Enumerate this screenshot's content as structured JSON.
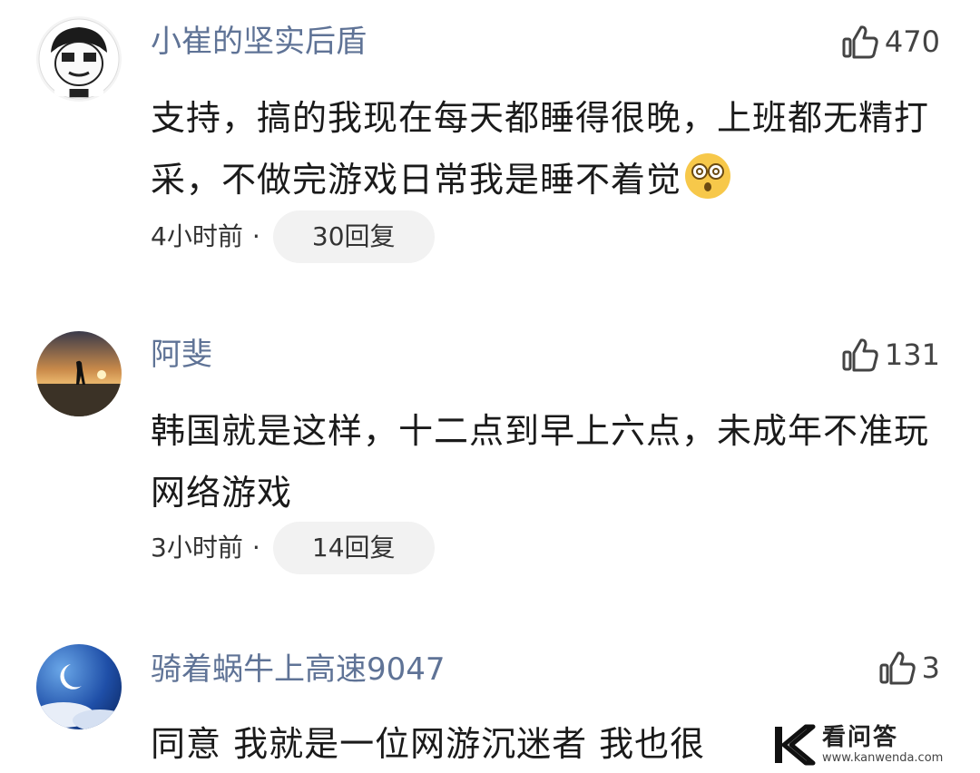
{
  "comments": [
    {
      "username": "小崔的坚实后盾",
      "likes": "470",
      "text": "支持，搞的我现在每天都睡得很晚，上班都无精打采，不做完游戏日常我是睡不着觉",
      "emoji": "dizzy-face-emoji",
      "time": "4小时前",
      "dot": "·",
      "reply_label": "30回复"
    },
    {
      "username": "阿斐",
      "likes": "131",
      "text": "韩国就是这样，十二点到早上六点，未成年不准玩网络游戏",
      "time": "3小时前",
      "dot": "·",
      "reply_label": "14回复"
    },
    {
      "username": "骑着蜗牛上高速9047",
      "likes": "3",
      "text": "同意 我就是一位网游沉迷者 我也很"
    }
  ],
  "watermark": {
    "title": "看问答",
    "url": "www.kanwenda.com"
  },
  "colors": {
    "username": "#5f7396",
    "text": "#1a1a1a",
    "reply_bg": "#f2f2f2"
  }
}
